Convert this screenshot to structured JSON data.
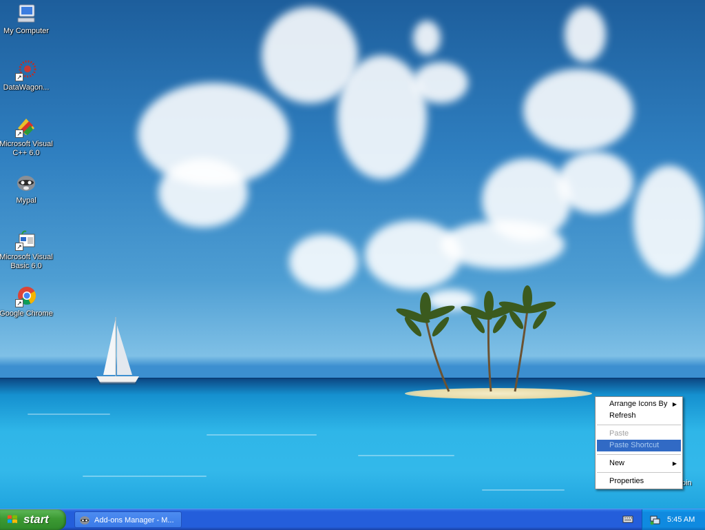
{
  "desktop": {
    "icons": [
      {
        "label": "My Computer",
        "icon": "my-computer-icon"
      },
      {
        "label": "DataWagon...",
        "icon": "datawagon-icon"
      },
      {
        "label": "Microsoft Visual C++ 6.0",
        "icon": "visual-cpp-icon"
      },
      {
        "label": "Mypal",
        "icon": "mypal-icon"
      },
      {
        "label": "Microsoft Visual Basic 6.0",
        "icon": "visual-basic-icon"
      },
      {
        "label": "Google Chrome",
        "icon": "chrome-icon"
      }
    ],
    "partial_icon_label": "bin"
  },
  "context_menu": {
    "items": [
      {
        "label": "Arrange Icons By",
        "submenu": true
      },
      {
        "label": "Refresh"
      },
      {
        "label": "Paste",
        "disabled": true
      },
      {
        "label": "Paste Shortcut",
        "disabled": true,
        "highlighted": true
      },
      {
        "label": "New",
        "submenu": true
      },
      {
        "label": "Properties"
      }
    ],
    "submenu_arrow": "▶"
  },
  "taskbar": {
    "start_label": "start",
    "task_button_label": "Add-ons Manager - M...",
    "clock": "5:45 AM",
    "colors": {
      "taskbar": "#245edb",
      "start": "#3c9a33",
      "tray": "#0f8ae0",
      "highlight": "#316ac5"
    }
  }
}
